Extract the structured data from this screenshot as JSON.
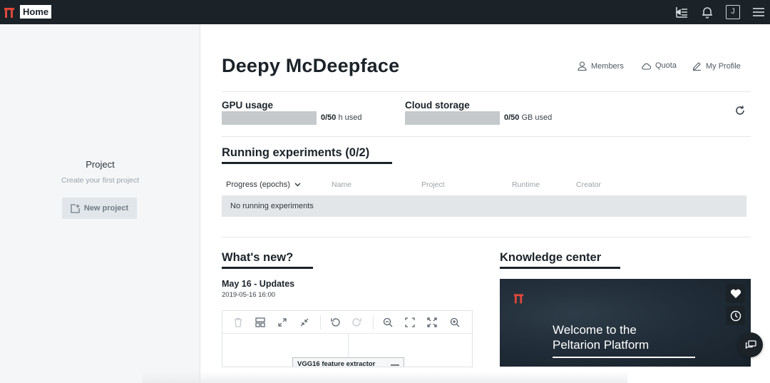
{
  "topbar": {
    "home_label": "Home",
    "avatar_initial": "J",
    "icons": [
      "deploy-list-icon",
      "bell-icon",
      "menu-icon"
    ]
  },
  "sidebar": {
    "project_title": "Project",
    "project_subtitle": "Create your first project",
    "new_project_label": "New project"
  },
  "header": {
    "user_name": "Deepy McDeepface",
    "links": {
      "members": "Members",
      "quota": "Quota",
      "my_profile": "My Profile"
    }
  },
  "usage": {
    "gpu": {
      "label": "GPU usage",
      "value": "0/50",
      "unit": "h used",
      "fraction": 0
    },
    "storage": {
      "label": "Cloud storage",
      "value": "0/50",
      "unit": "GB used",
      "fraction": 0
    }
  },
  "experiments": {
    "title": "Running experiments (0/2)",
    "columns": [
      "Progress (epochs)",
      "Name",
      "Project",
      "Runtime",
      "Creator"
    ],
    "empty_message": "No running experiments"
  },
  "whats_new": {
    "title": "What's new?",
    "post_title": "May 16 - Updates",
    "post_date": "2019-05-16 16:00",
    "preview_node": "VGG16 feature extractor"
  },
  "knowledge": {
    "title": "Knowledge center",
    "card_line1": "Welcome to the",
    "card_line2": "Peltarion Platform"
  },
  "colors": {
    "topbar": "#1b2329",
    "sidebar": "#f4f6f8",
    "accent_red": "#e0473a",
    "usage_bar": "#c5c9cc"
  }
}
